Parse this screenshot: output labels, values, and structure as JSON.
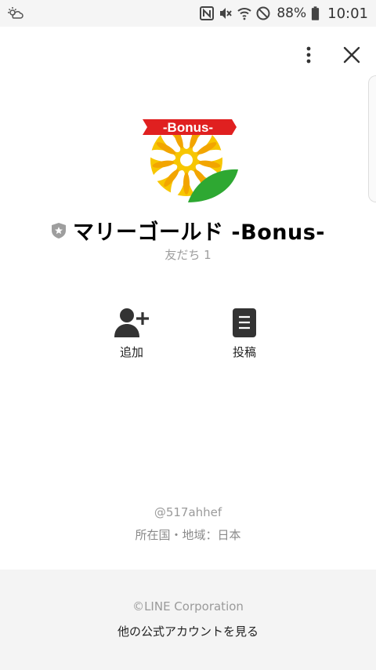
{
  "status_bar": {
    "battery_percent": "88%",
    "time": "10:01",
    "icons": [
      "weather-icon",
      "nfc-icon",
      "vibrate-off-icon",
      "wifi-icon",
      "do-not-disturb-icon",
      "battery-icon"
    ]
  },
  "header": {
    "menu_icon": "more-vertical-icon",
    "close_icon": "close-icon"
  },
  "profile": {
    "logo_text": "-Bonus-",
    "name": "マリーゴールド -Bonus-",
    "friends": "友だち 1",
    "badge_icon": "shield-icon"
  },
  "actions": [
    {
      "label": "追加",
      "icon": "add-friend-icon"
    },
    {
      "label": "投稿",
      "icon": "post-icon"
    }
  ],
  "info": {
    "account_id": "@517ahhef",
    "location": "所在国・地域：日本"
  },
  "footer": {
    "copyright": "©LINE Corporation",
    "other_accounts": "他の公式アカウントを見る"
  },
  "colors": {
    "logo_red": "#e02020",
    "petal_yellow": "#f2b705",
    "leaf_green": "#2ea832",
    "footer_bg": "#f4f4f4"
  }
}
